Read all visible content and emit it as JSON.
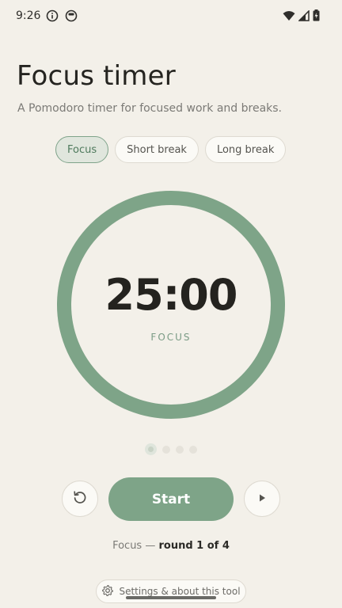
{
  "status_bar": {
    "time": "9:26",
    "left_icons": [
      "info-icon",
      "app-icon"
    ],
    "right_icons": [
      "wifi-icon",
      "signal-icon",
      "battery-icon"
    ]
  },
  "header": {
    "title": "Focus timer",
    "subtitle": "A Pomodoro timer for focused work and breaks."
  },
  "mode_tabs": [
    {
      "label": "Focus",
      "active": true
    },
    {
      "label": "Short break",
      "active": false
    },
    {
      "label": "Long break",
      "active": false
    }
  ],
  "timer": {
    "time": "25:00",
    "mode_label": "FOCUS",
    "progress": 1.0,
    "ring_color": "#7ea488"
  },
  "rounds": {
    "current": 1,
    "total": 4
  },
  "controls": {
    "start_label": "Start",
    "reset_icon": "reset-icon",
    "skip_icon": "play-icon"
  },
  "round_status": {
    "mode": "Focus",
    "separator": " — ",
    "text": "round 1 of 4"
  },
  "settings": {
    "label": "Settings & about this tool",
    "icon": "gear-icon"
  },
  "colors": {
    "background": "#f3f0e9",
    "accent": "#7ea488",
    "text": "#2b2a26",
    "muted": "#7b7a76"
  }
}
